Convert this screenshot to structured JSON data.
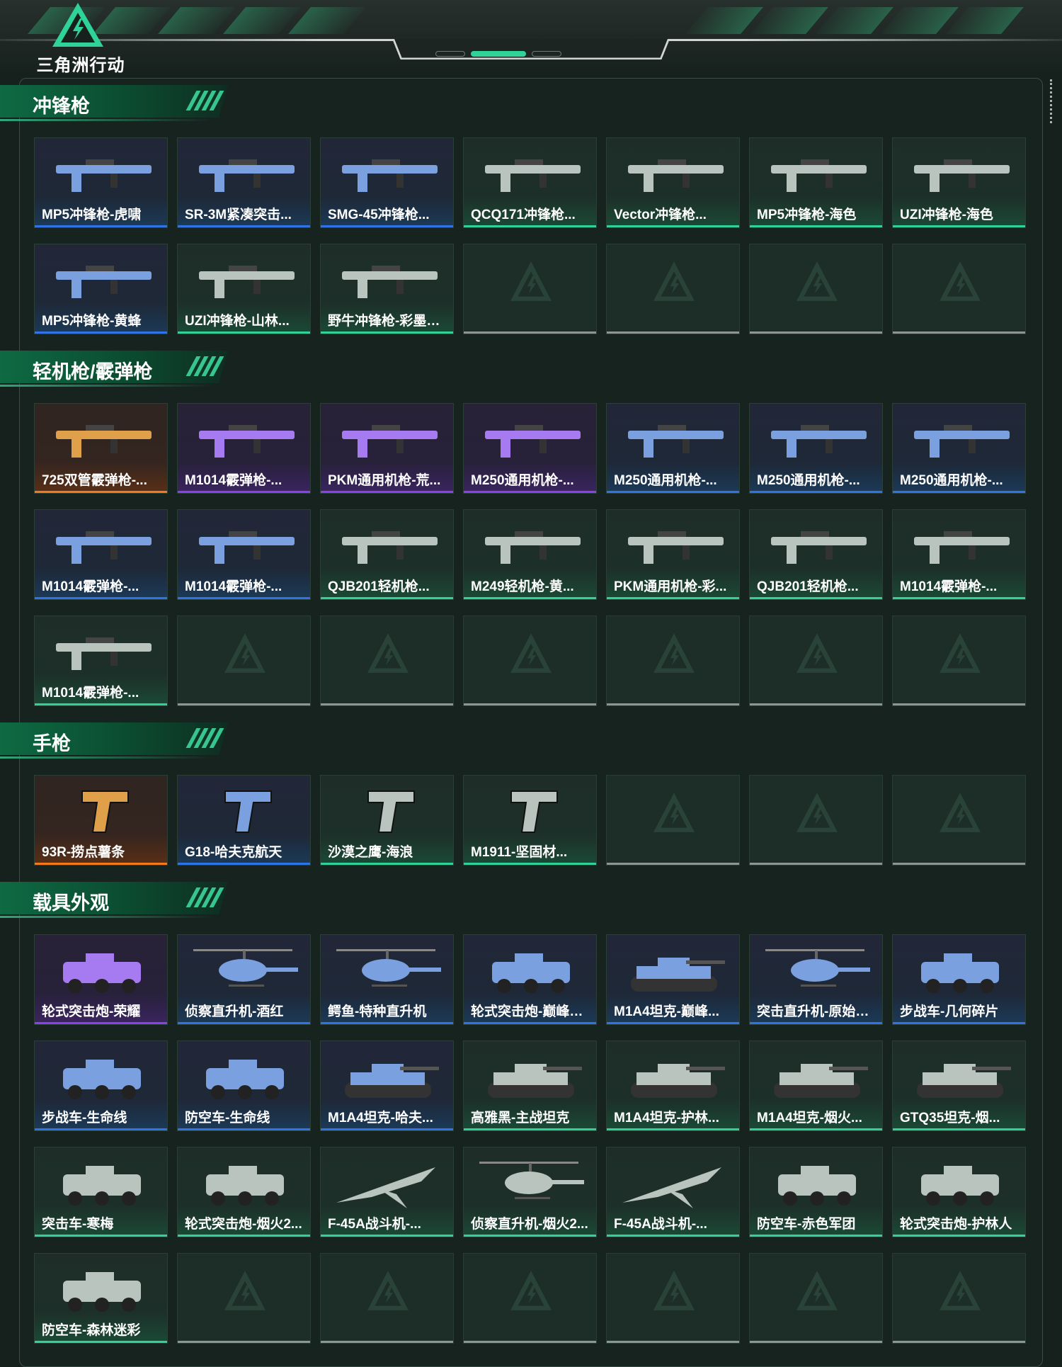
{
  "header": {
    "logo_text": "三角洲行动",
    "pager": {
      "count": 3,
      "active_index": 1
    }
  },
  "colors": {
    "accent": "#2fd39a",
    "rarity_blue": "#2f73e6",
    "rarity_purple": "#8a3ff0",
    "rarity_green": "#2fd39a",
    "rarity_orange": "#f27a1c",
    "empty_bar": "#8e9692"
  },
  "sections": [
    {
      "title": "冲锋枪",
      "items": [
        {
          "name": "MP5冲锋枪-虎啸",
          "rarity": "blue",
          "icon": "gun-icon"
        },
        {
          "name": "SR-3M紧凑突击...",
          "rarity": "blue",
          "icon": "gun-icon"
        },
        {
          "name": "SMG-45冲锋枪...",
          "rarity": "blue",
          "icon": "gun-icon"
        },
        {
          "name": "QCQ171冲锋枪...",
          "rarity": "green",
          "icon": "gun-icon"
        },
        {
          "name": "Vector冲锋枪...",
          "rarity": "green",
          "icon": "gun-icon"
        },
        {
          "name": "MP5冲锋枪-海色",
          "rarity": "green",
          "icon": "gun-icon"
        },
        {
          "name": "UZI冲锋枪-海色",
          "rarity": "green",
          "icon": "gun-icon"
        },
        {
          "name": "MP5冲锋枪-黄蜂",
          "rarity": "blue",
          "icon": "gun-icon"
        },
        {
          "name": "UZI冲锋枪-山林...",
          "rarity": "green",
          "icon": "gun-icon"
        },
        {
          "name": "野牛冲锋枪-彩墨喷...",
          "rarity": "green",
          "icon": "gun-icon"
        },
        null,
        null,
        null,
        null
      ]
    },
    {
      "title": "轻机枪/霰弹枪",
      "items": [
        {
          "name": "725双管霰弹枪-...",
          "rarity": "orange",
          "icon": "gun-icon"
        },
        {
          "name": "M1014霰弹枪-...",
          "rarity": "purple",
          "icon": "gun-icon"
        },
        {
          "name": "PKM通用机枪-荒...",
          "rarity": "purple",
          "icon": "gun-icon"
        },
        {
          "name": "M250通用机枪-...",
          "rarity": "purple",
          "icon": "gun-icon"
        },
        {
          "name": "M250通用机枪-...",
          "rarity": "blue",
          "icon": "gun-icon"
        },
        {
          "name": "M250通用机枪-...",
          "rarity": "blue",
          "icon": "gun-icon"
        },
        {
          "name": "M250通用机枪-...",
          "rarity": "blue",
          "icon": "gun-icon"
        },
        {
          "name": "M1014霰弹枪-...",
          "rarity": "blue",
          "icon": "gun-icon"
        },
        {
          "name": "M1014霰弹枪-...",
          "rarity": "blue",
          "icon": "gun-icon"
        },
        {
          "name": "QJB201轻机枪...",
          "rarity": "green",
          "icon": "gun-icon"
        },
        {
          "name": "M249轻机枪-黄...",
          "rarity": "green",
          "icon": "gun-icon"
        },
        {
          "name": "PKM通用机枪-彩...",
          "rarity": "green",
          "icon": "gun-icon"
        },
        {
          "name": "QJB201轻机枪...",
          "rarity": "green",
          "icon": "gun-icon"
        },
        {
          "name": "M1014霰弹枪-...",
          "rarity": "green",
          "icon": "gun-icon"
        },
        {
          "name": "M1014霰弹枪-...",
          "rarity": "green",
          "icon": "gun-icon"
        },
        null,
        null,
        null,
        null,
        null,
        null
      ]
    },
    {
      "title": "手枪",
      "items": [
        {
          "name": "93R-捞点薯条",
          "rarity": "orange",
          "icon": "pistol-icon"
        },
        {
          "name": "G18-哈夫克航天",
          "rarity": "blue",
          "icon": "pistol-icon"
        },
        {
          "name": "沙漠之鹰-海浪",
          "rarity": "green",
          "icon": "pistol-icon"
        },
        {
          "name": "M1911-坚固材...",
          "rarity": "green",
          "icon": "pistol-icon"
        },
        null,
        null,
        null
      ]
    },
    {
      "title": "载具外观",
      "items": [
        {
          "name": "轮式突击炮-荣耀",
          "rarity": "purple",
          "icon": "vehicle-icon"
        },
        {
          "name": "侦察直升机-酒红",
          "rarity": "blue",
          "icon": "helicopter-icon"
        },
        {
          "name": "鳄鱼-特种直升机",
          "rarity": "blue",
          "icon": "helicopter-icon"
        },
        {
          "name": "轮式突击炮-巅峰竞...",
          "rarity": "blue",
          "icon": "vehicle-icon"
        },
        {
          "name": "M1A4坦克-巅峰...",
          "rarity": "blue",
          "icon": "tank-icon"
        },
        {
          "name": "突击直升机-原始伪...",
          "rarity": "blue",
          "icon": "helicopter-icon"
        },
        {
          "name": "步战车-几何碎片",
          "rarity": "blue",
          "icon": "vehicle-icon"
        },
        {
          "name": "步战车-生命线",
          "rarity": "blue",
          "icon": "vehicle-icon"
        },
        {
          "name": "防空车-生命线",
          "rarity": "blue",
          "icon": "vehicle-icon"
        },
        {
          "name": "M1A4坦克-哈夫...",
          "rarity": "blue",
          "icon": "tank-icon"
        },
        {
          "name": "高雅黑-主战坦克",
          "rarity": "green",
          "icon": "tank-icon"
        },
        {
          "name": "M1A4坦克-护林...",
          "rarity": "green",
          "icon": "tank-icon"
        },
        {
          "name": "M1A4坦克-烟火...",
          "rarity": "green",
          "icon": "tank-icon"
        },
        {
          "name": "GTQ35坦克-烟...",
          "rarity": "green",
          "icon": "tank-icon"
        },
        {
          "name": "突击车-寒梅",
          "rarity": "green",
          "icon": "vehicle-icon"
        },
        {
          "name": "轮式突击炮-烟火2...",
          "rarity": "green",
          "icon": "vehicle-icon"
        },
        {
          "name": "F-45A战斗机-...",
          "rarity": "green",
          "icon": "jet-icon"
        },
        {
          "name": "侦察直升机-烟火2...",
          "rarity": "green",
          "icon": "helicopter-icon"
        },
        {
          "name": "F-45A战斗机-...",
          "rarity": "green",
          "icon": "jet-icon"
        },
        {
          "name": "防空车-赤色军团",
          "rarity": "green",
          "icon": "vehicle-icon"
        },
        {
          "name": "轮式突击炮-护林人",
          "rarity": "green",
          "icon": "vehicle-icon"
        },
        {
          "name": "防空车-森林迷彩",
          "rarity": "green",
          "icon": "vehicle-icon"
        },
        null,
        null,
        null,
        null,
        null,
        null
      ]
    }
  ]
}
